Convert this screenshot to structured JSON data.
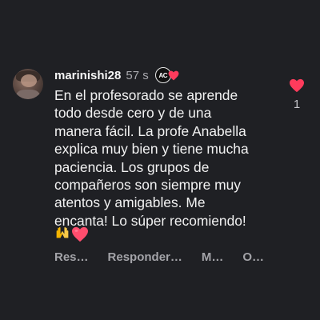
{
  "comment": {
    "username": "marinishi28",
    "time": "57 s",
    "badge_text": "AC",
    "text": "En el profesorado se aprende\ntodo desde cero y de una\nmanera fácil. La profe Anabella\nexplica muy bien y tiene mucha\npaciencia. Los grupos de\ncompañeros son siempre muy\natentos y amigables. Me\nencanta! Lo súper recomiendo!",
    "emojis": [
      "raised-hands",
      "heart"
    ],
    "actions": {
      "reply_short": "Res…",
      "reply": "Responder…",
      "more_m": "M…",
      "more_o": "O…"
    },
    "likes": "1"
  },
  "colors": {
    "background": "#1f2024",
    "text": "#f2f2f2",
    "muted": "#a3a3a8",
    "heart": "#ff3b5c"
  }
}
